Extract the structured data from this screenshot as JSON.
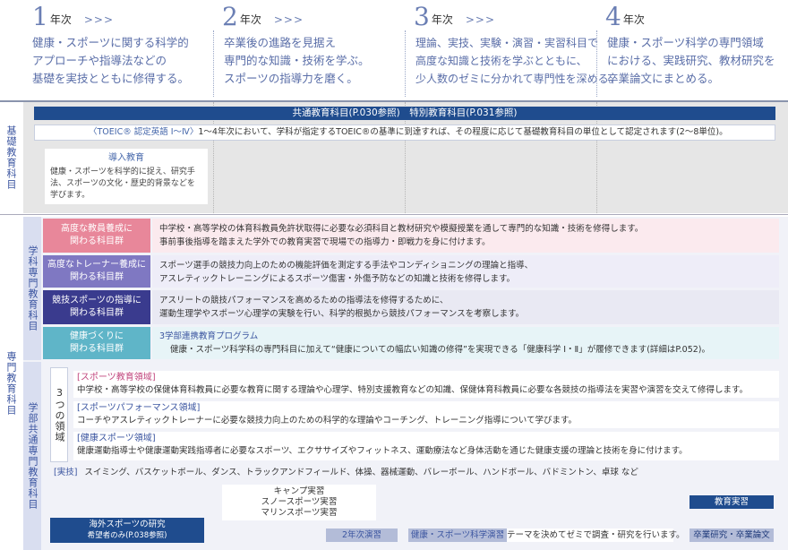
{
  "years": [
    {
      "num": "1",
      "label": "年次",
      "arrows": ">>>",
      "desc": "健康・スポーツに関する科学的\nアプローチや指導法などの\n基礎を実技とともに修得する。"
    },
    {
      "num": "2",
      "label": "年次",
      "arrows": ">>>",
      "desc": "卒業後の進路を見据え\n専門的な知識・技術を学ぶ。\nスポーツの指導力を磨く。"
    },
    {
      "num": "3",
      "label": "年次",
      "arrows": ">>>",
      "desc": "理論、実技、実験・演習・実習科目で\n高度な知識と技術を学ぶとともに、\n少人数のゼミに分かれて専門性を深める。"
    },
    {
      "num": "4",
      "label": "年次",
      "arrows": "",
      "desc": "健康・スポーツ科学の専門領域\nにおける、実践研究、教材研究を\n卒業論文にまとめる。"
    }
  ],
  "basic": {
    "label": "基礎教育科目",
    "banner": "共通教育科目(P.030参照)　特別教育科目(P.031参照)",
    "toeic_title": "〈TOEIC® 認定英語 Ⅰ〜Ⅳ〉",
    "toeic_text": "1〜4年次において、学科が指定するTOEIC®の基準に到達すれば、その程度に応じて基礎教育科目の単位として認定されます(2〜8単位)。",
    "intro_title": "導入教育",
    "intro_text": "健康・スポーツを科学的に捉え、研究手法、スポーツの文化・歴史的背景などを学びます。"
  },
  "specialist": {
    "label": "専門教育科目",
    "dept_label": "学科専門教育科目",
    "faculty_label": "学部共通専門教育科目",
    "categories": [
      {
        "name": "高度な教員養成に\n関わる科目群",
        "color": "#e8879a",
        "desc1": "中学校・高等学校の体育科教員免許状取得に必要な必須科目と教材研究や模擬授業を通して専門的な知識・技術を修得します。",
        "desc2": "事前事後指導を踏まえた学外での教育実習で現場での指導力・即戦力を身に付けます。",
        "bg": "#fbeaee"
      },
      {
        "name": "高度なトレーナー養成に\n関わる科目群",
        "color": "#7f78c2",
        "desc1": "スポーツ選手の競技力向上のための機能評価を測定する手法やコンディショニングの理論と指導、",
        "desc2": "アスレティックトレーニングによるスポーツ傷害・外傷予防などの知識と技術を修得します。",
        "bg": "#eeedf8"
      },
      {
        "name": "競技スポーツの指導に\n関わる科目群",
        "color": "#3a3b8e",
        "desc1": "アスリートの競技パフォーマンスを高めるための指導法を修得するために、",
        "desc2": "運動生理学やスポーツ心理学の実験を行い、科学的根拠から競技パフォーマンスを考察します。",
        "bg": "#e9e9f3"
      },
      {
        "name": "健康づくりに\n関わる科目群",
        "color": "#5fb5c8",
        "desc1": "3学部連携教育プログラム",
        "desc2": "健康・スポーツ科学科の専門科目に加えて“健康についての幅広い知識の修得”を実現できる「健康科学 Ⅰ・Ⅱ」が履修できます(詳細はP.052)。",
        "bg": "#e7f4f7"
      }
    ],
    "three_domains_label": "3つの領域",
    "domains": [
      {
        "title": "[スポーツ教育領域]",
        "text": "中学校・高等学校の保健体育科教員に必要な教育に関する理論や心理学、特別支援教育などの知識、保健体育科教員に必要な各競技の指導法を実習や演習を交えて修得します。"
      },
      {
        "title": "[スポーツパフォーマンス領域]",
        "text": "コーチやアスレティックトレーナーに必要な競技力向上のための科学的な理論やコーチング、トレーニング指導について学びます。"
      },
      {
        "title": "[健康スポーツ領域]",
        "text": "健康運動指導士や健康運動実践指導者に必要なスポーツ、エクササイズやフィットネス、運動療法など身体活動を通じた健康支援の理論と技術を身に付けます。"
      }
    ],
    "practice_tag": "[実技]",
    "practice_text": "スイミング、バスケットボール、ダンス、トラックアンドフィールド、体操、器械運動、バレーボール、ハンドボール、バドミントン、卓球 など",
    "camp": [
      "キャンプ実習",
      "スノースポーツ実習",
      "マリンスポーツ実習"
    ],
    "overseas_title": "海外スポーツの研究",
    "overseas_sub": "希望者のみ(P.038参照)",
    "seminar2": "2年次演習",
    "seminar3": "健康・スポーツ科学演習",
    "seminar3_text": "テーマを決めてゼミで調査・研究を行います。",
    "teaching_practice": "教育実習",
    "thesis": "卒業研究・卒業論文"
  }
}
